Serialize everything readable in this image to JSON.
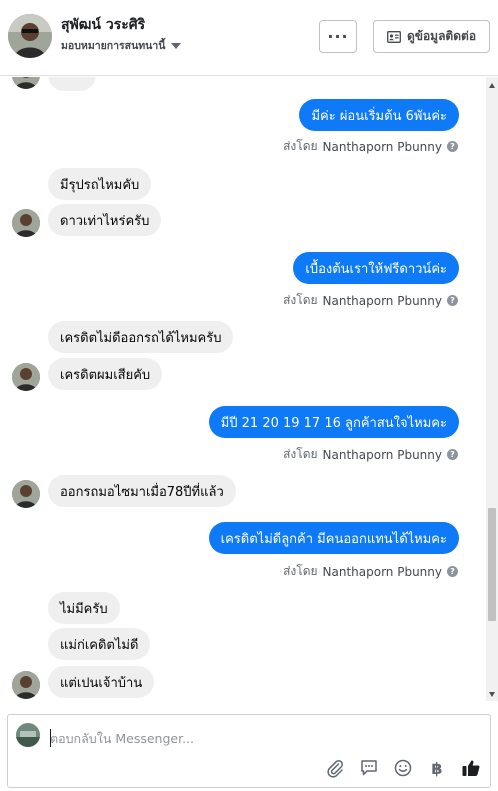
{
  "header": {
    "contact_name": "สุพัฒน์ วระศิริ",
    "assign_label": "มอบหมายการสนทนานี้",
    "more_label": "···",
    "info_button_label": "ดูข้อมูลติดต่อ"
  },
  "messages": [
    {
      "dir": "out",
      "text": "มีค่ะ ผ่อนเริ่มต้น 6พันค่ะ"
    },
    {
      "dir": "sentby",
      "prefix": "ส่งโดย",
      "name": "Nanthaporn Pbunny"
    },
    {
      "dir": "in",
      "text": "มีรุปรถไหมคับ"
    },
    {
      "dir": "in",
      "text": "ดาวเท่าไหร่ครับ"
    },
    {
      "dir": "out",
      "text": "เบื้องต้นเราให้ฟรีดาวน์ค่ะ"
    },
    {
      "dir": "sentby",
      "prefix": "ส่งโดย",
      "name": "Nanthaporn Pbunny"
    },
    {
      "dir": "in",
      "text": "เครดิตไม่ดีออกรถได้ไหมครับ"
    },
    {
      "dir": "in",
      "text": "เครดิตผมเสียคับ"
    },
    {
      "dir": "out",
      "text": "มีปี 21 20 19 17 16  ลูกค้าสนใจไหมคะ"
    },
    {
      "dir": "sentby",
      "prefix": "ส่งโดย",
      "name": "Nanthaporn Pbunny"
    },
    {
      "dir": "in",
      "text": "ออกรถมอไซมาเมื่อ78ปีที่แล้ว"
    },
    {
      "dir": "out",
      "text": "เครดิตไม่ดีลูกค้า มีคนออกแทนได้ไหมคะ"
    },
    {
      "dir": "sentby",
      "prefix": "ส่งโดย",
      "name": "Nanthaporn Pbunny"
    },
    {
      "dir": "in",
      "text": "ไม่มีครับ"
    },
    {
      "dir": "in",
      "text": "แม่ก่เคดิตไม่ดี"
    },
    {
      "dir": "in",
      "text": "แต่เปนเจ้าบ้าน"
    }
  ],
  "composer": {
    "placeholder": "ตอบกลับใน Messenger...",
    "tools": [
      "paperclip-icon",
      "chat-icon",
      "emoji-icon",
      "baht-icon",
      "thumbs-up-icon"
    ],
    "baht_symbol": "฿"
  },
  "colors": {
    "outgoing_bubble": "#0e7af8",
    "incoming_bubble": "#efefef",
    "border": "#dddfe2"
  }
}
